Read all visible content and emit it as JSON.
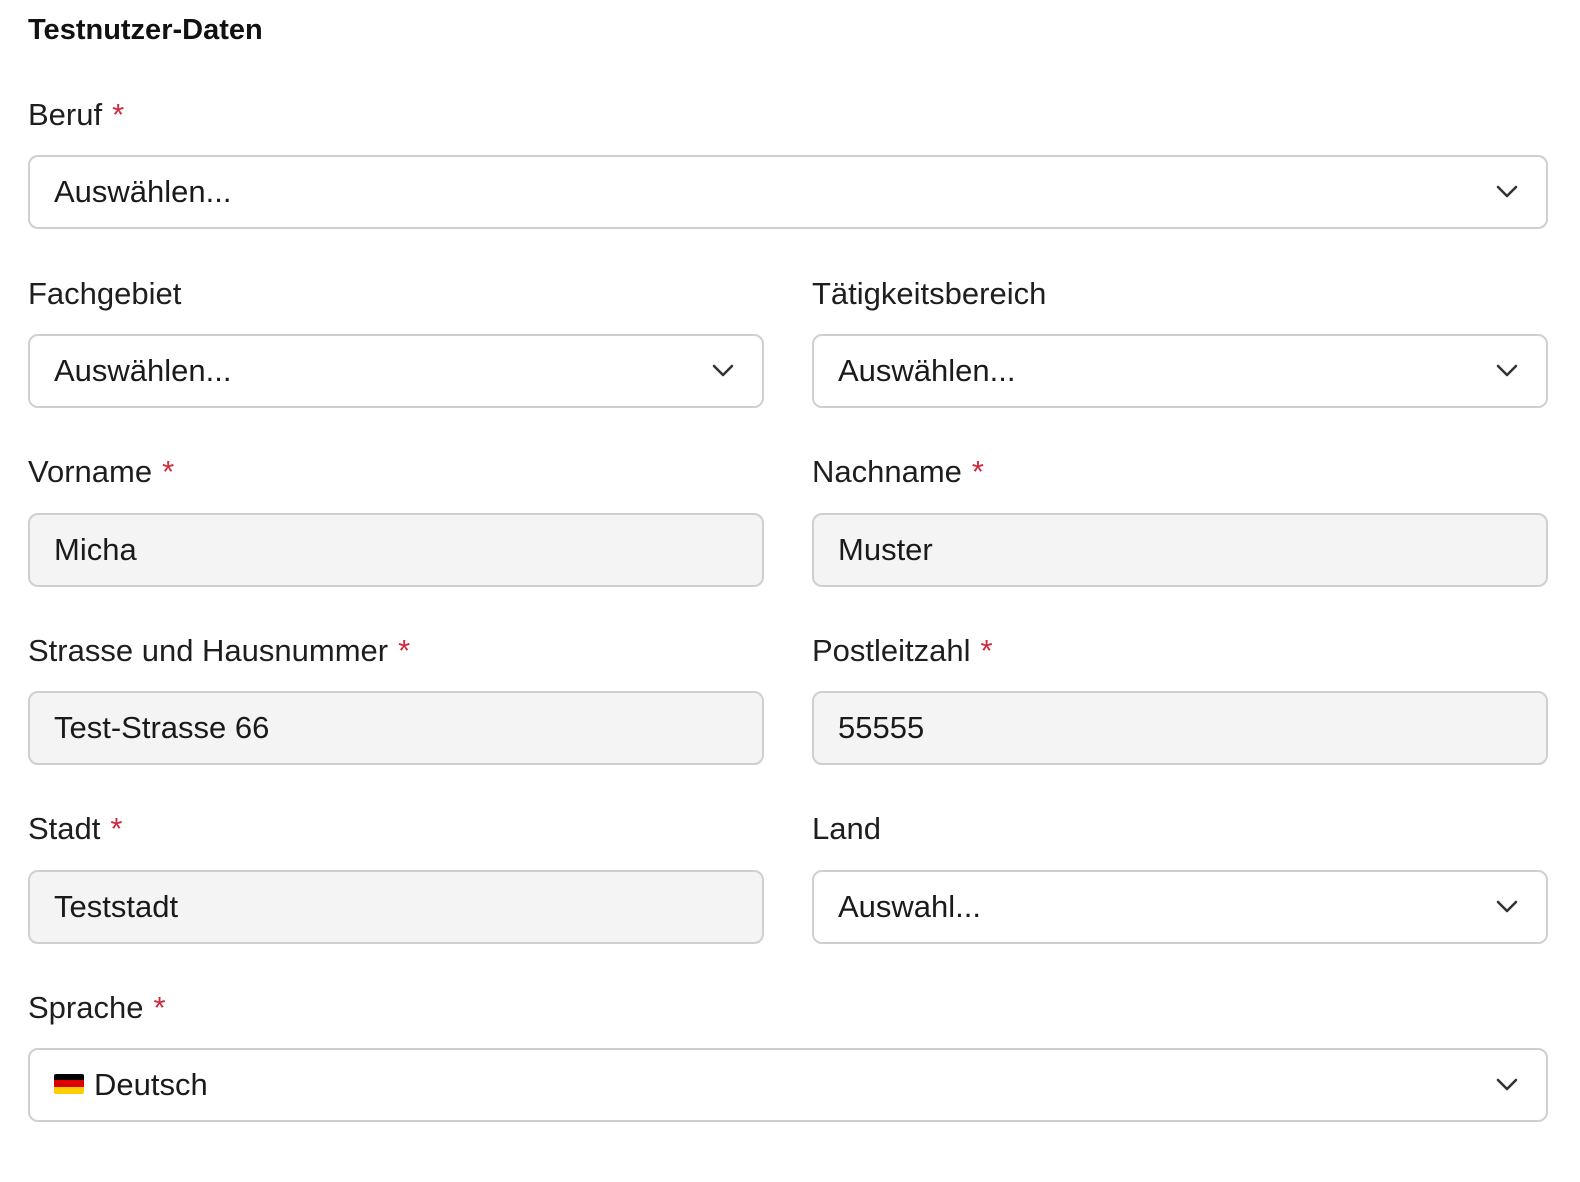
{
  "section": {
    "title": "Testnutzer-Daten"
  },
  "required_mark": "*",
  "fields": {
    "beruf": {
      "label": "Beruf",
      "value": "Auswählen..."
    },
    "fachgebiet": {
      "label": "Fachgebiet",
      "value": "Auswählen..."
    },
    "taetigkeitsbereich": {
      "label": "Tätigkeitsbereich",
      "value": "Auswählen..."
    },
    "vorname": {
      "label": "Vorname",
      "value": "Micha"
    },
    "nachname": {
      "label": "Nachname",
      "value": "Muster"
    },
    "strasse": {
      "label": "Strasse und Hausnummer",
      "value": "Test-Strasse 66"
    },
    "postleitzahl": {
      "label": "Postleitzahl",
      "value": "55555"
    },
    "stadt": {
      "label": "Stadt",
      "value": "Teststadt"
    },
    "land": {
      "label": "Land",
      "value": "Auswahl..."
    },
    "sprache": {
      "label": "Sprache",
      "value": "Deutsch",
      "flag_icon": "germany-flag-icon"
    }
  },
  "colors": {
    "required": "#d0283c",
    "input_bg": "#f4f4f4",
    "border": "#cfcfcf"
  }
}
